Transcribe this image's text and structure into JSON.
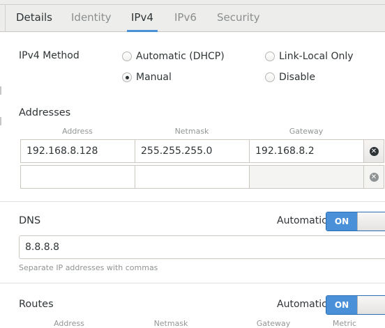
{
  "tabs": [
    {
      "label": "Details"
    },
    {
      "label": "Identity"
    },
    {
      "label": "IPv4"
    },
    {
      "label": "IPv6"
    },
    {
      "label": "Security"
    }
  ],
  "ipv4_method": {
    "label": "IPv4 Method",
    "options": [
      {
        "label": "Automatic (DHCP)",
        "checked": false
      },
      {
        "label": "Link-Local Only",
        "checked": false
      },
      {
        "label": "Manual",
        "checked": true
      },
      {
        "label": "Disable",
        "checked": false
      }
    ]
  },
  "addresses": {
    "title": "Addresses",
    "columns": [
      "Address",
      "Netmask",
      "Gateway"
    ],
    "rows": [
      {
        "address": "192.168.8.128",
        "netmask": "255.255.255.0",
        "gateway": "192.168.8.2"
      },
      {
        "address": "",
        "netmask": "",
        "gateway": ""
      }
    ]
  },
  "dns": {
    "title": "DNS",
    "automatic_label": "Automatic",
    "switch_label": "ON",
    "value": "8.8.8.8",
    "hint": "Separate IP addresses with commas"
  },
  "routes": {
    "title": "Routes",
    "automatic_label": "Automatic",
    "switch_label": "ON",
    "columns": [
      "Address",
      "Netmask",
      "Gateway",
      "Metric"
    ]
  },
  "colors": {
    "accent": "#4a90d9",
    "text": "#2e3436",
    "muted": "#8b8e8f"
  }
}
